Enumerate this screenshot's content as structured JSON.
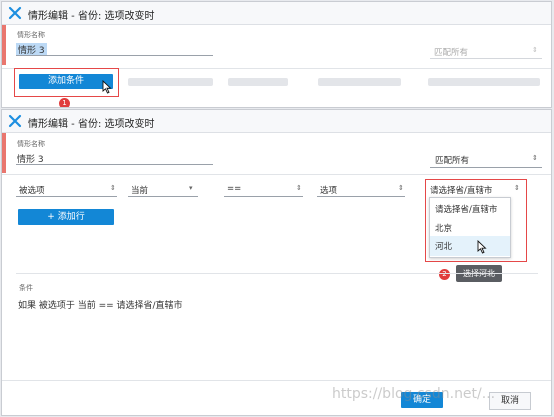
{
  "dialog1": {
    "title": "情形编辑 - 省份: 选项改变时",
    "name_label": "情形名称",
    "name_value": "情形 3",
    "match_value": "匹配所有",
    "add_condition_label": "添加条件",
    "step_badge": "1"
  },
  "dialog2": {
    "title": "情形编辑 - 省份: 选项改变时",
    "name_label": "情形名称",
    "name_value": "情形 3",
    "match_value": "匹配所有",
    "condition_row": {
      "field1": "被选项",
      "field2": "当前",
      "operator": "==",
      "field3": "选项",
      "value_select": "请选择省/直辖市"
    },
    "dropdown_options": [
      "请选择省/直辖市",
      "北京",
      "河北"
    ],
    "add_row_label": "+ 添加行",
    "step_badge": "2",
    "tooltip": "选择河北",
    "condition_label": "条件",
    "condition_text": "如果 被选项于 当前 == 请选择省/直辖市",
    "ok_label": "确定",
    "cancel_label": "取消",
    "watermark": "https://blog.csdn.net/..."
  },
  "colors": {
    "primary": "#1387d6",
    "accent": "#e9766e",
    "highlight_box": "#e54848"
  }
}
